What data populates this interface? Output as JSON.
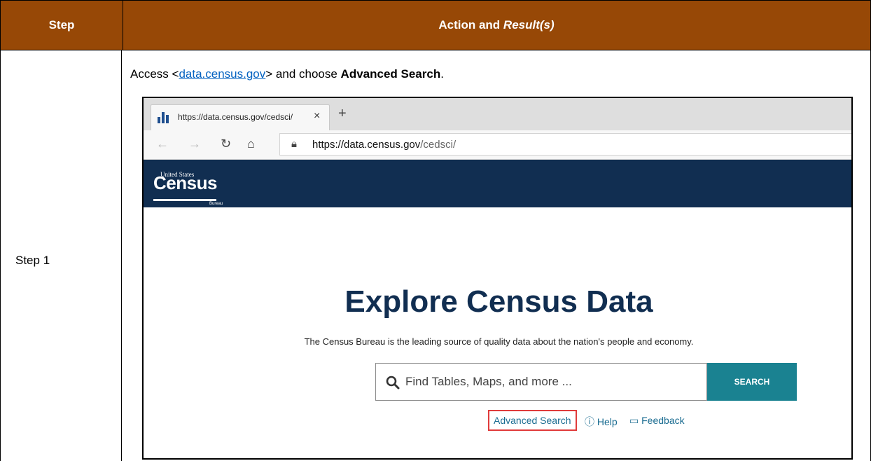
{
  "table": {
    "header": {
      "step": "Step",
      "action_prefix": "Action and ",
      "action_italic": "Result(s)"
    },
    "row": {
      "step_label": "Step 1",
      "instruction": {
        "prefix": "Access <",
        "link": "data.census.gov",
        "middle": "> and choose ",
        "bold": "Advanced Search",
        "suffix": "."
      }
    }
  },
  "browser": {
    "tab": {
      "title": "https://data.census.gov/cedsci/",
      "close": "×",
      "new": "+"
    },
    "address": {
      "host": "https://data.census.gov",
      "path": "/cedsci/"
    },
    "icons": [
      "back-arrow-icon",
      "forward-arrow-icon",
      "reload-icon",
      "home-icon",
      "lock-icon"
    ]
  },
  "site": {
    "logo": {
      "small": "United States",
      "big": "Census",
      "bureau": "Bureau"
    },
    "hero_title": "Explore Census Data",
    "hero_subtitle": "The Census Bureau is the leading source of quality data about the nation's people and economy.",
    "search": {
      "placeholder": "Find Tables, Maps, and more ...",
      "button": "SEARCH"
    },
    "links": {
      "advanced": "Advanced Search",
      "help": "Help",
      "feedback": "Feedback"
    }
  },
  "colors": {
    "header_bg": "#974806",
    "site_header_bg": "#112e51",
    "search_button_bg": "#1a8291",
    "highlight_border": "#e03b3b"
  }
}
